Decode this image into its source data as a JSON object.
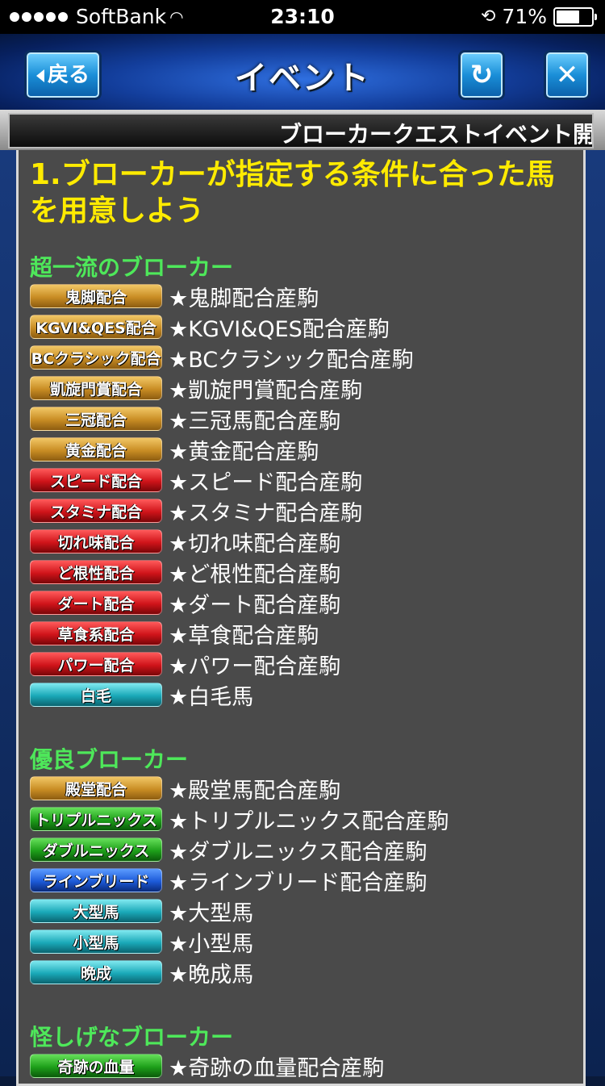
{
  "status": {
    "carrier": "SoftBank",
    "time": "23:10",
    "battery": "71%",
    "battery_fraction": 0.71
  },
  "header": {
    "title": "イベント",
    "back_label": "戻る",
    "refresh_icon": "refresh-icon",
    "close_icon": "close-icon"
  },
  "ticker": {
    "text": "ブローカークエストイベント開始"
  },
  "panel": {
    "title": "1.ブローカーが指定する条件に合った馬を用意しよう",
    "sections": [
      {
        "heading": "超一流のブローカー",
        "items": [
          {
            "badge": "鬼脚配合",
            "color": "gold",
            "text": "★鬼脚配合産駒"
          },
          {
            "badge": "KGVI&QES配合",
            "color": "gold",
            "text": "★KGVI&QES配合産駒"
          },
          {
            "badge": "BCクラシック配合",
            "color": "gold",
            "text": "★BCクラシック配合産駒"
          },
          {
            "badge": "凱旋門賞配合",
            "color": "gold",
            "text": "★凱旋門賞配合産駒"
          },
          {
            "badge": "三冠配合",
            "color": "gold",
            "text": "★三冠馬配合産駒"
          },
          {
            "badge": "黄金配合",
            "color": "gold",
            "text": "★黄金配合産駒"
          },
          {
            "badge": "スピード配合",
            "color": "red",
            "text": "★スピード配合産駒"
          },
          {
            "badge": "スタミナ配合",
            "color": "red",
            "text": "★スタミナ配合産駒"
          },
          {
            "badge": "切れ味配合",
            "color": "red",
            "text": "★切れ味配合産駒"
          },
          {
            "badge": "ど根性配合",
            "color": "red",
            "text": "★ど根性配合産駒"
          },
          {
            "badge": "ダート配合",
            "color": "red",
            "text": "★ダート配合産駒"
          },
          {
            "badge": "草食系配合",
            "color": "red",
            "text": "★草食配合産駒"
          },
          {
            "badge": "パワー配合",
            "color": "red",
            "text": "★パワー配合産駒"
          },
          {
            "badge": "白毛",
            "color": "teal",
            "text": "★白毛馬"
          }
        ]
      },
      {
        "heading": "優良ブローカー",
        "items": [
          {
            "badge": "殿堂配合",
            "color": "gold",
            "text": "★殿堂馬配合産駒"
          },
          {
            "badge": "トリプルニックス",
            "color": "green",
            "text": "★トリプルニックス配合産駒"
          },
          {
            "badge": "ダブルニックス",
            "color": "green",
            "text": "★ダブルニックス配合産駒"
          },
          {
            "badge": "ラインブリード",
            "color": "blue",
            "text": "★ラインブリード配合産駒"
          },
          {
            "badge": "大型馬",
            "color": "teal",
            "text": "★大型馬"
          },
          {
            "badge": "小型馬",
            "color": "teal",
            "text": "★小型馬"
          },
          {
            "badge": "晩成",
            "color": "teal",
            "text": "★晩成馬"
          }
        ]
      },
      {
        "heading": "怪しげなブローカー",
        "items": [
          {
            "badge": "奇跡の血量",
            "color": "green",
            "text": "★奇跡の血量配合産駒"
          }
        ]
      }
    ]
  }
}
